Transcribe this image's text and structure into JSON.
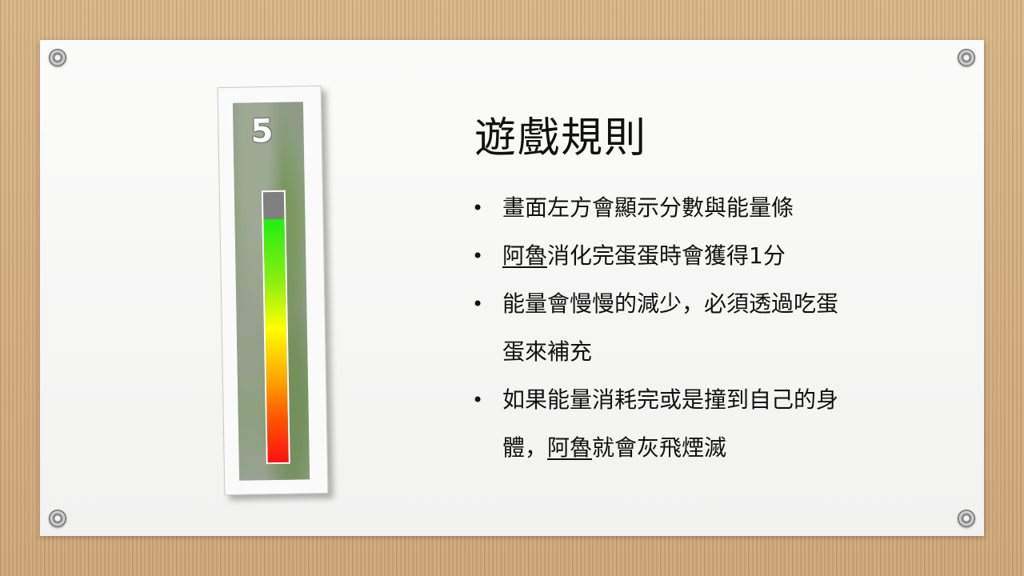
{
  "slide": {
    "title": "遊戲規則",
    "bullet_symbol": "•",
    "rules": [
      {
        "segments": [
          {
            "text": "畫面左方會顯示分數與能量條",
            "underline": false
          }
        ]
      },
      {
        "segments": [
          {
            "text": "阿魯",
            "underline": true
          },
          {
            "text": "消化完蛋蛋時會獲得1分",
            "underline": false
          }
        ]
      },
      {
        "segments": [
          {
            "text": "能量會慢慢的減少，必須透過吃蛋蛋來補充",
            "underline": false
          }
        ]
      },
      {
        "segments": [
          {
            "text": "如果能量消耗完或是撞到自己的身體，",
            "underline": false
          },
          {
            "text": "阿魯",
            "underline": true
          },
          {
            "text": "就會灰飛煙滅",
            "underline": false
          }
        ]
      }
    ]
  },
  "game_preview": {
    "score": "5",
    "energy_fraction": 0.9,
    "energy_colors": [
      "#22ee11",
      "#ffff00",
      "#ff1111"
    ]
  },
  "icons": {
    "pins": [
      "pushpin-icon",
      "pushpin-icon",
      "pushpin-icon",
      "pushpin-icon"
    ]
  }
}
